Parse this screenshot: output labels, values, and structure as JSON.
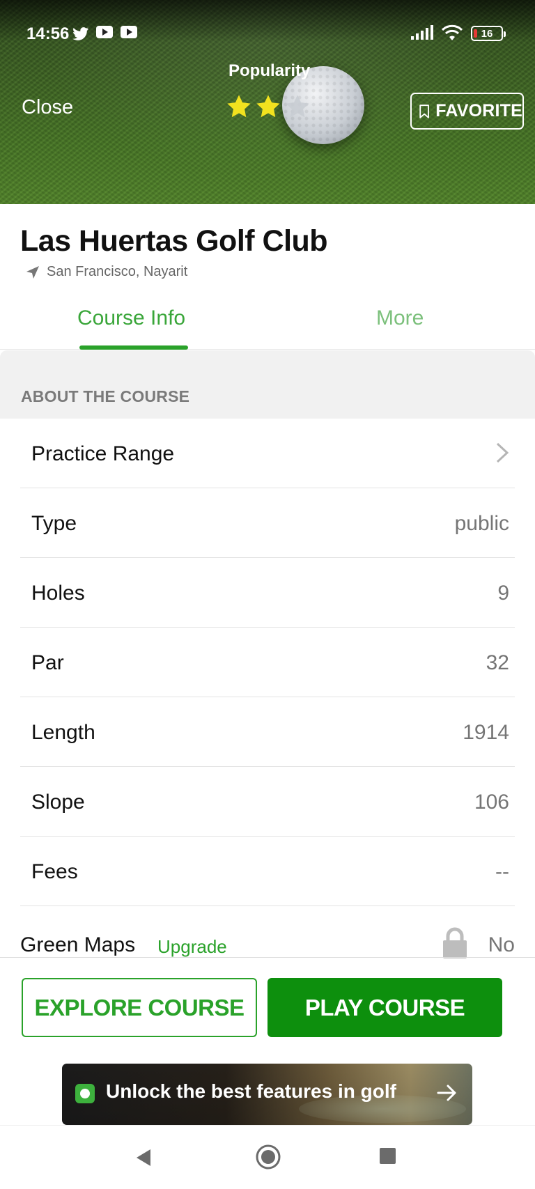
{
  "status_bar": {
    "time": "14:56",
    "battery": "16"
  },
  "header": {
    "close_label": "Close",
    "popularity_label": "Popularity",
    "rating": {
      "filled": 2,
      "total": 3
    },
    "favorite_label": "FAVORITE"
  },
  "course": {
    "name": "Las Huertas Golf Club",
    "location": "San Francisco, Nayarit"
  },
  "tabs": [
    {
      "label": "Course Info",
      "active": true
    },
    {
      "label": "More",
      "active": false
    }
  ],
  "section": {
    "title": "ABOUT THE COURSE",
    "rows": [
      {
        "label": "Practice Range",
        "value": "",
        "chevron": true
      },
      {
        "label": "Type",
        "value": "public"
      },
      {
        "label": "Holes",
        "value": "9"
      },
      {
        "label": "Par",
        "value": "32"
      },
      {
        "label": "Length",
        "value": "1914"
      },
      {
        "label": "Slope",
        "value": "106"
      },
      {
        "label": "Fees",
        "value": "--"
      }
    ],
    "green_maps": {
      "label": "Green Maps",
      "upgrade_label": "Upgrade",
      "value": "No"
    }
  },
  "actions": {
    "explore_label": "EXPLORE COURSE",
    "play_label": "PLAY COURSE"
  },
  "promo": {
    "text": "Unlock the best features in golf"
  },
  "colors": {
    "accent_green": "#2aa22a",
    "play_button_green": "#0d8f0d",
    "star_yellow": "#f2e21f",
    "star_empty": "#c8ccd2"
  }
}
